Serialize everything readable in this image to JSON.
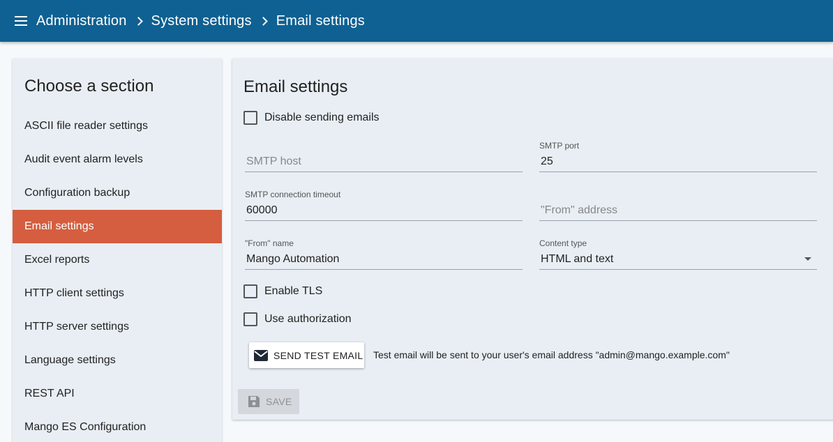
{
  "header": {
    "breadcrumbs": [
      "Administration",
      "System settings",
      "Email settings"
    ]
  },
  "sidebar": {
    "title": "Choose a section",
    "items": [
      {
        "label": "ASCII file reader settings"
      },
      {
        "label": "Audit event alarm levels"
      },
      {
        "label": "Configuration backup"
      },
      {
        "label": "Email settings"
      },
      {
        "label": "Excel reports"
      },
      {
        "label": "HTTP client settings"
      },
      {
        "label": "HTTP server settings"
      },
      {
        "label": "Language settings"
      },
      {
        "label": "REST API"
      },
      {
        "label": "Mango ES Configuration"
      }
    ],
    "active_index": 3
  },
  "form": {
    "title": "Email settings",
    "disable_sending": {
      "label": "Disable sending emails",
      "checked": false
    },
    "smtp_host": {
      "label": "",
      "placeholder": "SMTP host",
      "value": ""
    },
    "smtp_port": {
      "label": "SMTP port",
      "value": "25"
    },
    "smtp_timeout": {
      "label": "SMTP connection timeout",
      "value": "60000"
    },
    "from_address": {
      "label": "",
      "placeholder": "\"From\" address",
      "value": ""
    },
    "from_name": {
      "label": "\"From\" name",
      "value": "Mango Automation"
    },
    "content_type": {
      "label": "Content type",
      "value": "HTML and text"
    },
    "enable_tls": {
      "label": "Enable TLS",
      "checked": false
    },
    "use_auth": {
      "label": "Use authorization",
      "checked": false
    },
    "send_test_label": "SEND TEST EMAIL",
    "test_note": "Test email will be sent to your user's email address \"admin@mango.example.com\"",
    "save_label": "SAVE"
  },
  "icons": {
    "menu": "menu-icon",
    "chevron": "chevron-right-icon",
    "mail": "email-icon",
    "save": "floppy-disk-icon",
    "dropdown": "arrow-drop-down-icon"
  },
  "colors": {
    "header_bg": "#0e6192",
    "active_item_bg": "#d45e3f",
    "panel_bg": "#e8eef4"
  }
}
